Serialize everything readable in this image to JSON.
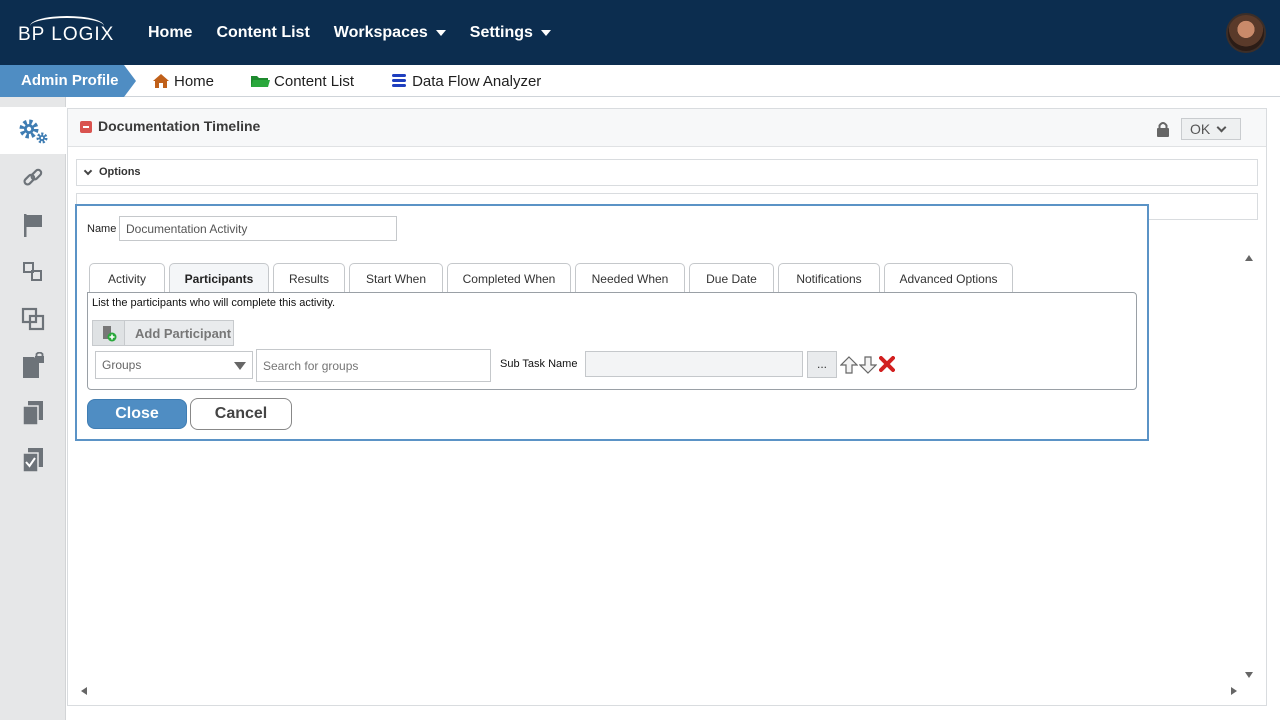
{
  "topbar": {
    "logo_text": "BP LOGIX",
    "nav": [
      {
        "label": "Home"
      },
      {
        "label": "Content List"
      },
      {
        "label": "Workspaces"
      },
      {
        "label": "Settings"
      }
    ],
    "bg_color": "#0c2d4f"
  },
  "breadcrumb": {
    "profile": "Admin Profile",
    "items": [
      {
        "label": "Home",
        "icon": "house-icon"
      },
      {
        "label": "Content List",
        "icon": "folder-icon"
      },
      {
        "label": "Data Flow Analyzer",
        "icon": "database-icon"
      }
    ]
  },
  "sidebar": {
    "items": [
      {
        "icon": "gears-icon",
        "active": true
      },
      {
        "icon": "link-icon"
      },
      {
        "icon": "flag-icon"
      },
      {
        "icon": "hierarchy-icon"
      },
      {
        "icon": "overlap-squares-icon"
      },
      {
        "icon": "locked-document-icon"
      },
      {
        "icon": "copy-icon"
      },
      {
        "icon": "checked-document-icon"
      }
    ]
  },
  "main": {
    "title": "Documentation Timeline",
    "ok_label": "OK",
    "sections": [
      {
        "label": "Options"
      }
    ]
  },
  "dialog": {
    "name_label": "Name",
    "name_value": "Documentation Activity",
    "tabs": [
      {
        "label": "Activity"
      },
      {
        "label": "Participants",
        "active": true
      },
      {
        "label": "Results"
      },
      {
        "label": "Start When"
      },
      {
        "label": "Completed When"
      },
      {
        "label": "Needed When"
      },
      {
        "label": "Due Date"
      },
      {
        "label": "Notifications"
      },
      {
        "label": "Advanced Options"
      }
    ],
    "panel": {
      "description": "List the participants who will complete this activity.",
      "add_participant": "Add Participant",
      "groups_selected": "Groups",
      "search_placeholder": "Search for groups",
      "subtask_label": "Sub Task Name",
      "subtask_value": "",
      "dots_label": "..."
    },
    "close_label": "Close",
    "cancel_label": "Cancel"
  },
  "colors": {
    "accent": "#4f8dc3",
    "delete": "#d21f1f"
  }
}
